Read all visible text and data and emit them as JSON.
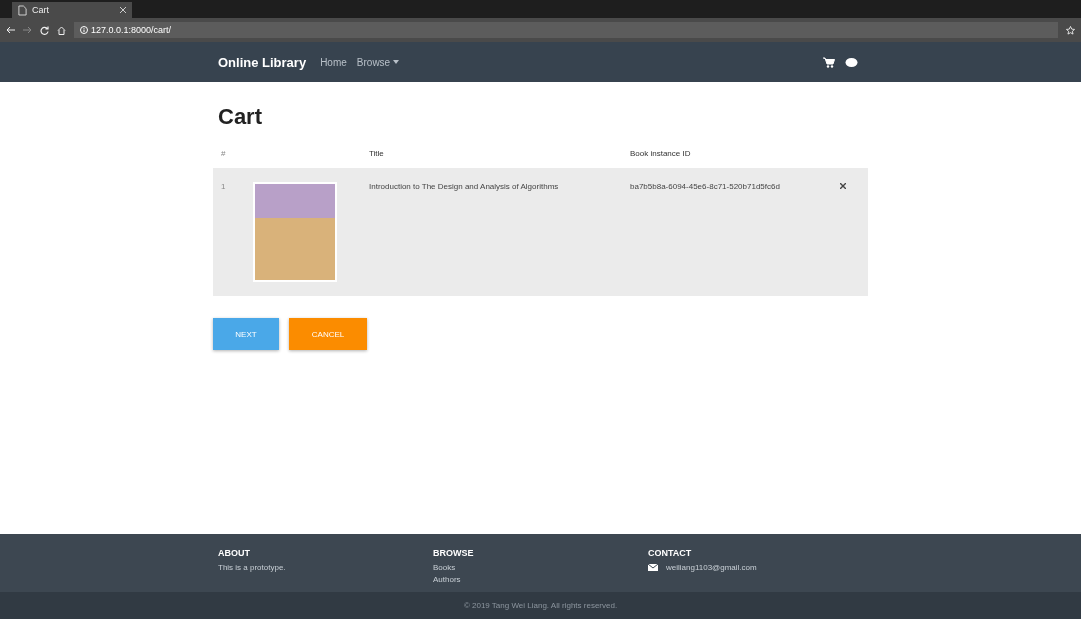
{
  "browser": {
    "tab_title": "Cart",
    "address": "127.0.0.1:8000/cart/"
  },
  "navbar": {
    "brand": "Online Library",
    "links": [
      {
        "label": "Home",
        "kind": "link"
      },
      {
        "label": "Browse",
        "kind": "dropdown"
      }
    ]
  },
  "page": {
    "heading": "Cart"
  },
  "table": {
    "columns": [
      "#",
      "",
      "Title",
      "Book instance ID",
      ""
    ],
    "rows": [
      {
        "index": "1",
        "title": "Introduction to The Design and Analysis of Algorithms",
        "instance_id": "ba7b5b8a-6094-45e6-8c71-520b71d5fc6d"
      }
    ]
  },
  "buttons": [
    {
      "label": "NEXT",
      "kind": "primary"
    },
    {
      "label": "CANCEL",
      "kind": "warning"
    }
  ],
  "footer": {
    "about": {
      "heading": "ABOUT",
      "text": "This is a prototype."
    },
    "browse": {
      "heading": "BROWSE",
      "links": [
        "Books",
        "Authors"
      ]
    },
    "contact": {
      "heading": "CONTACT",
      "email": "weiliang1103@gmail.com"
    },
    "copyright": "© 2019 Tang Wei Liang. All rights reserved."
  }
}
